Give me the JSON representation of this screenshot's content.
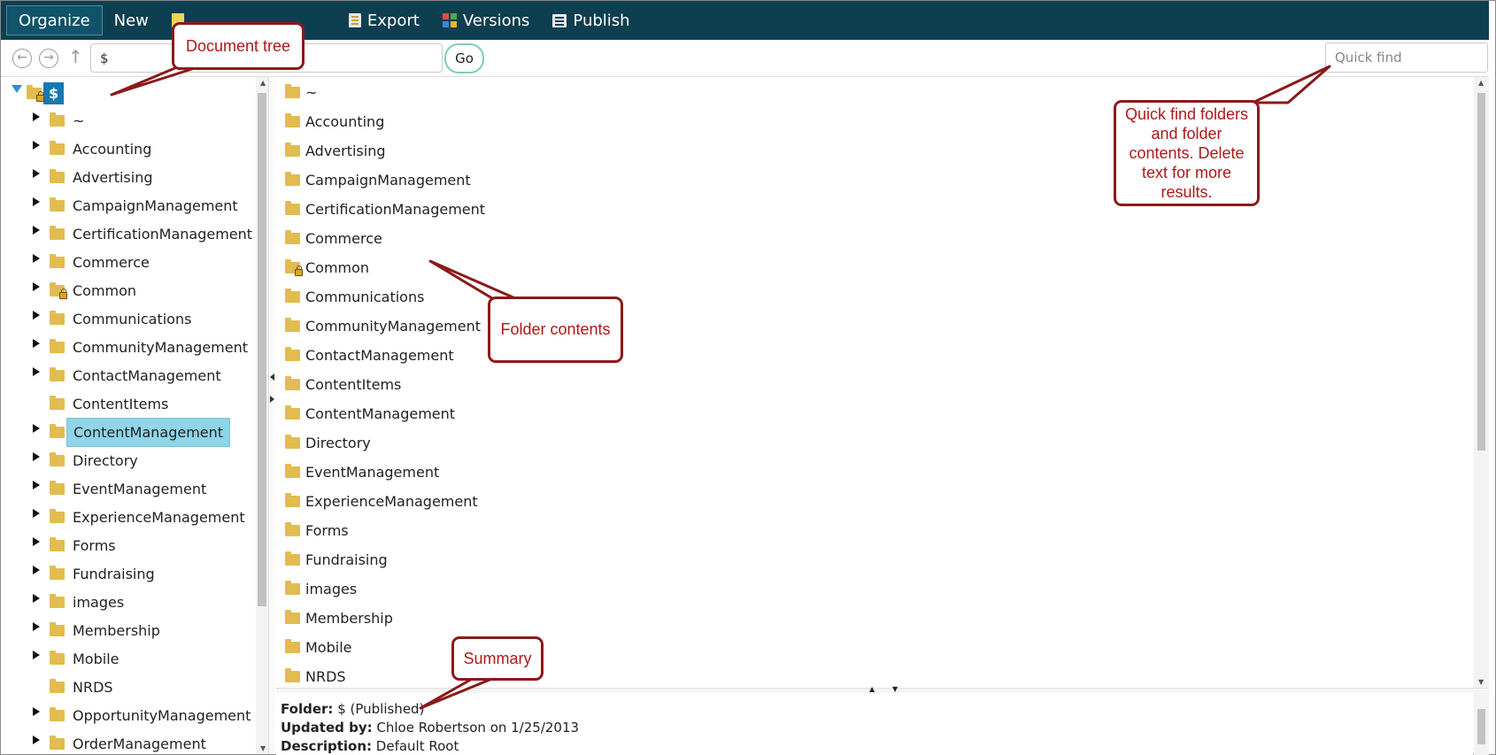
{
  "toolbar": {
    "organize": "Organize",
    "new": "New",
    "export": "Export",
    "versions": "Versions",
    "publish": "Publish"
  },
  "nav": {
    "path": "$",
    "go": "Go",
    "quick_find_placeholder": "Quick find"
  },
  "tree": {
    "root": "$",
    "items": [
      {
        "label": "~",
        "expandable": true
      },
      {
        "label": "Accounting",
        "expandable": true
      },
      {
        "label": "Advertising",
        "expandable": true
      },
      {
        "label": "CampaignManagement",
        "expandable": true
      },
      {
        "label": "CertificationManagement",
        "expandable": true
      },
      {
        "label": "Commerce",
        "expandable": true
      },
      {
        "label": "Common",
        "expandable": true,
        "locked": true
      },
      {
        "label": "Communications",
        "expandable": true
      },
      {
        "label": "CommunityManagement",
        "expandable": true
      },
      {
        "label": "ContactManagement",
        "expandable": true
      },
      {
        "label": "ContentItems",
        "expandable": false
      },
      {
        "label": "ContentManagement",
        "expandable": true,
        "selected": true
      },
      {
        "label": "Directory",
        "expandable": true
      },
      {
        "label": "EventManagement",
        "expandable": true
      },
      {
        "label": "ExperienceManagement",
        "expandable": true
      },
      {
        "label": "Forms",
        "expandable": true
      },
      {
        "label": "Fundraising",
        "expandable": true
      },
      {
        "label": "images",
        "expandable": true
      },
      {
        "label": "Membership",
        "expandable": true
      },
      {
        "label": "Mobile",
        "expandable": true
      },
      {
        "label": "NRDS",
        "expandable": false
      },
      {
        "label": "OpportunityManagement",
        "expandable": true
      },
      {
        "label": "OrderManagement",
        "expandable": true
      }
    ]
  },
  "contents": {
    "items": [
      {
        "label": "~"
      },
      {
        "label": "Accounting"
      },
      {
        "label": "Advertising"
      },
      {
        "label": "CampaignManagement"
      },
      {
        "label": "CertificationManagement"
      },
      {
        "label": "Commerce"
      },
      {
        "label": "Common",
        "locked": true
      },
      {
        "label": "Communications"
      },
      {
        "label": "CommunityManagement"
      },
      {
        "label": "ContactManagement"
      },
      {
        "label": "ContentItems"
      },
      {
        "label": "ContentManagement"
      },
      {
        "label": "Directory"
      },
      {
        "label": "EventManagement"
      },
      {
        "label": "ExperienceManagement"
      },
      {
        "label": "Forms"
      },
      {
        "label": "Fundraising"
      },
      {
        "label": "images"
      },
      {
        "label": "Membership"
      },
      {
        "label": "Mobile"
      },
      {
        "label": "NRDS"
      }
    ]
  },
  "summary": {
    "folder_label": "Folder:",
    "folder_value": "$ (Published)",
    "updated_label": "Updated by:",
    "updated_value": "Chloe Robertson on 1/25/2013",
    "description_label": "Description:",
    "description_value": "Default Root"
  },
  "annotations": {
    "document_tree": "Document tree",
    "folder_contents": "Folder contents",
    "quick_find_lines": [
      "Quick find folders",
      "and folder",
      "contents. Delete",
      "text for more",
      "results."
    ],
    "summary": "Summary"
  },
  "colors": {
    "toolbar_bg": "#0e3f50",
    "selected_bg": "#8fd4e8",
    "root_bg": "#1579b3",
    "folder": "#e2bc4e",
    "callout_border": "#8b1a1a",
    "callout_text": "#b01818"
  }
}
